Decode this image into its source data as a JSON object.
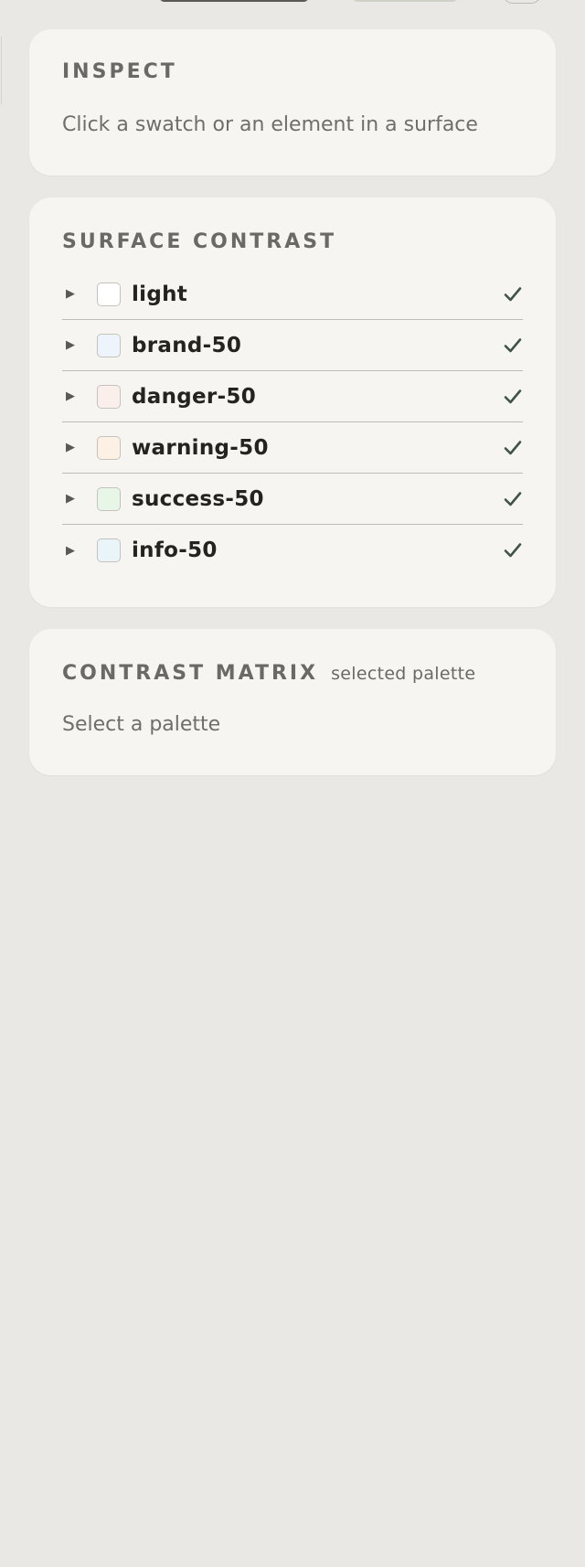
{
  "inspect": {
    "title": "INSPECT",
    "hint": "Click a swatch or an element in a surface"
  },
  "surface_contrast": {
    "title": "SURFACE CONTRAST",
    "items": [
      {
        "label": "light",
        "swatch_color": "#ffffff",
        "passes": true
      },
      {
        "label": "brand-50",
        "swatch_color": "#edf4fb",
        "passes": true
      },
      {
        "label": "danger-50",
        "swatch_color": "#fbefec",
        "passes": true
      },
      {
        "label": "warning-50",
        "swatch_color": "#fcf1e4",
        "passes": true
      },
      {
        "label": "success-50",
        "swatch_color": "#e8f6e8",
        "passes": true
      },
      {
        "label": "info-50",
        "swatch_color": "#eaf5fa",
        "passes": true
      }
    ],
    "check_color": "#3f5446",
    "caret_icon": "caret-right-icon"
  },
  "contrast_matrix": {
    "title": "CONTRAST MATRIX",
    "subtitle": "selected palette",
    "hint": "Select a palette"
  }
}
